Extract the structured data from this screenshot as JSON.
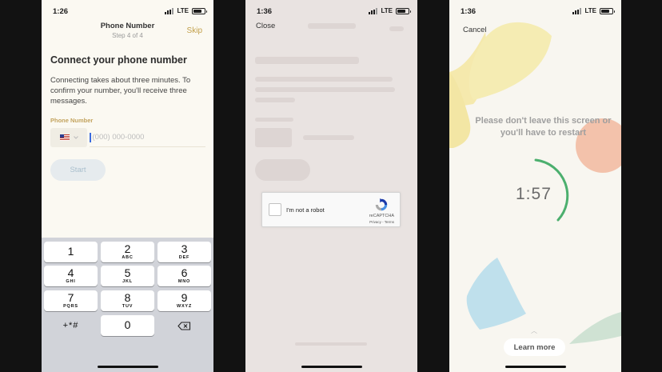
{
  "screen1": {
    "status": {
      "time": "1:26",
      "network": "LTE"
    },
    "nav": {
      "title": "Phone Number",
      "subtitle": "Step 4 of 4",
      "skip": "Skip"
    },
    "heading": "Connect your phone number",
    "description": "Connecting takes about three minutes. To confirm your number, you'll receive three messages.",
    "phone_label": "Phone Number",
    "country_flag": "us-flag-icon",
    "phone_placeholder": "(000) 000-0000",
    "start_label": "Start",
    "keypad": [
      {
        "num": "1",
        "letters": ""
      },
      {
        "num": "2",
        "letters": "ABC"
      },
      {
        "num": "3",
        "letters": "DEF"
      },
      {
        "num": "4",
        "letters": "GHI"
      },
      {
        "num": "5",
        "letters": "JKL"
      },
      {
        "num": "6",
        "letters": "MNO"
      },
      {
        "num": "7",
        "letters": "PQRS"
      },
      {
        "num": "8",
        "letters": "TUV"
      },
      {
        "num": "9",
        "letters": "WXYZ"
      },
      {
        "num": "+*#",
        "letters": ""
      },
      {
        "num": "0",
        "letters": ""
      },
      {
        "num": "delete-icon",
        "letters": ""
      }
    ]
  },
  "screen2": {
    "status": {
      "time": "1:36",
      "network": "LTE"
    },
    "close_label": "Close",
    "captcha": {
      "label": "I'm not a robot",
      "brand": "reCAPTCHA",
      "links": "Privacy - Terms"
    }
  },
  "screen3": {
    "status": {
      "time": "1:36",
      "network": "LTE"
    },
    "cancel_label": "Cancel",
    "message": "Please don't leave this screen or you'll have to restart",
    "timer": "1:57",
    "learn_more": "Learn more"
  },
  "colors": {
    "accent": "#c2a04b",
    "timer_ring": "#4caf6e",
    "link": "#3b6bdf"
  }
}
